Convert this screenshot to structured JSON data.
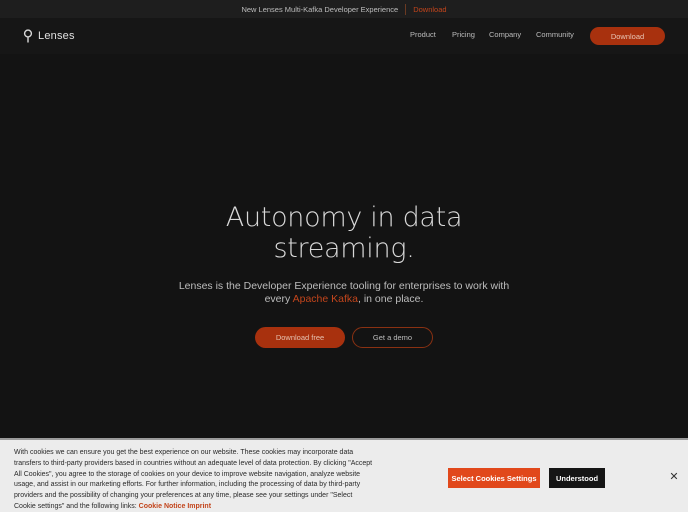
{
  "announcement": {
    "text": "New Lenses Multi-Kafka Developer Experience",
    "link": "Download"
  },
  "nav": {
    "logo": "Lenses",
    "links": [
      "Product",
      "Pricing",
      "Company",
      "Community"
    ],
    "cta": "Download"
  },
  "hero": {
    "title_line1": "Autonomy in data",
    "title_line2": "streaming.",
    "subtitle_line1": "Lenses is the Developer Experience tooling for enterprises to work with",
    "subtitle_prefix": "every ",
    "subtitle_highlight": "Apache Kafka",
    "subtitle_suffix": ", in one place.",
    "primary_button": "Download free",
    "secondary_button": "Get a demo"
  },
  "cookie": {
    "text": "With cookies we can ensure you get the best experience on our website. These cookies may incorporate data transfers to third-party providers based in countries without an adequate level of data protection. By clicking \"Accept All Cookies\", you agree to the storage of cookies on your device to improve website navigation, analyze website usage, and assist in our marketing efforts. For further information, including the processing of data by third-party providers and the possibility of changing your preferences at any time, please see your settings under \"Select Cookie settings\" and the following links:",
    "link_notice": "Cookie Notice",
    "link_imprint": "Imprint",
    "settings_button": "Select Cookies Settings",
    "understood_button": "Understood",
    "close": "✕"
  },
  "colors": {
    "accent": "#a8310e",
    "accent_text": "#c2451c",
    "cookie_button": "#e1481b"
  }
}
